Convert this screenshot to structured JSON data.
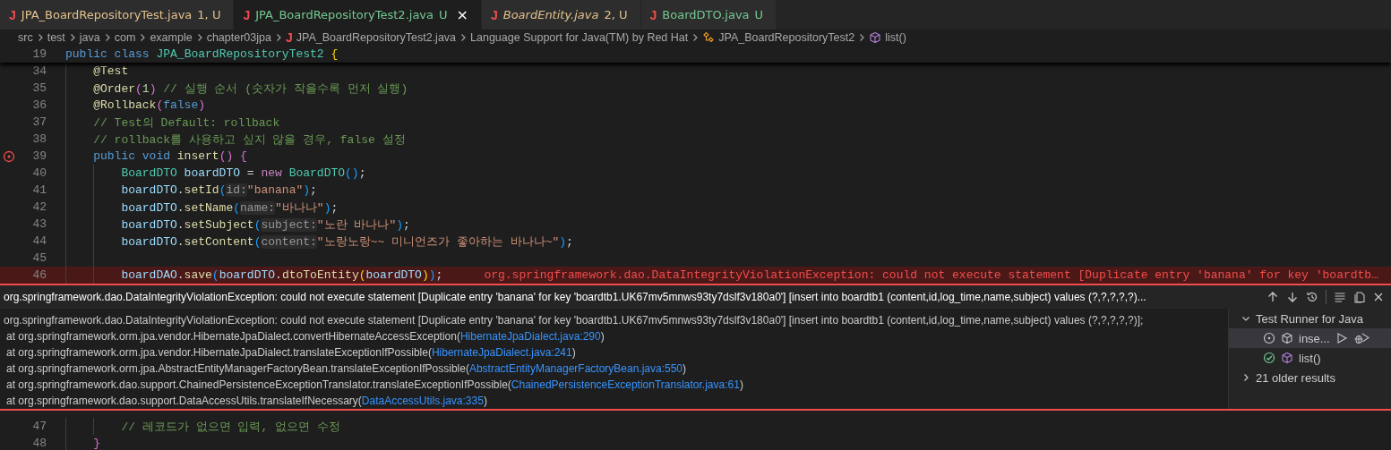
{
  "tabs": [
    {
      "icon": "J",
      "label": "JPA_BoardRepositoryTest.java",
      "status": "1, U",
      "color": "#e2c08d",
      "italic": false,
      "selected": false
    },
    {
      "icon": "J",
      "label": "JPA_BoardRepositoryTest2.java",
      "status": "U",
      "color": "#73c991",
      "italic": false,
      "selected": true,
      "close": "×"
    },
    {
      "icon": "J",
      "label": "BoardEntity.java",
      "status": "2, U",
      "color": "#e2c08d",
      "italic": true,
      "selected": false
    },
    {
      "icon": "J",
      "label": "BoardDTO.java",
      "status": "U",
      "color": "#73c991",
      "italic": false,
      "selected": false
    }
  ],
  "breadcrumb": [
    {
      "label": "src"
    },
    {
      "label": "test"
    },
    {
      "label": "java"
    },
    {
      "label": "com"
    },
    {
      "label": "example"
    },
    {
      "label": "chapter03jpa"
    },
    {
      "label": "JPA_BoardRepositoryTest2.java",
      "icon": "J"
    },
    {
      "label": "Language Support for Java(TM) by Red Hat"
    },
    {
      "label": "JPA_BoardRepositoryTest2",
      "kind": "class"
    },
    {
      "label": "list()",
      "kind": "method"
    }
  ],
  "sticky_line": {
    "number": "19",
    "tokens": [
      {
        "kind": "kw",
        "text": "public"
      },
      {
        "kind": "kw",
        "text": " class"
      },
      {
        "kind": "type",
        "text": " JPA_BoardRepositoryTest2"
      },
      {
        "kind": "b1",
        "text": " {"
      }
    ]
  },
  "code_lines": [
    {
      "number": "34",
      "kind": "member",
      "tokens": [
        {
          "kind": "fn",
          "text": "@Test"
        }
      ]
    },
    {
      "number": "35",
      "kind": "member",
      "tokens": [
        {
          "kind": "fn",
          "text": "@Order"
        },
        {
          "kind": "b2",
          "text": "("
        },
        {
          "kind": "num",
          "text": "1"
        },
        {
          "kind": "b2",
          "text": ")"
        },
        {
          "kind": "cmt",
          "text": " // 실행 순서 (숫자가 작을수록 먼저 실행)"
        }
      ]
    },
    {
      "number": "36",
      "kind": "member",
      "tokens": [
        {
          "kind": "fn",
          "text": "@Rollback"
        },
        {
          "kind": "b2",
          "text": "("
        },
        {
          "kind": "kw",
          "text": "false"
        },
        {
          "kind": "b2",
          "text": ")"
        }
      ]
    },
    {
      "number": "37",
      "kind": "member",
      "tokens": [
        {
          "kind": "cmt",
          "text": "// Test의 Default: rollback"
        }
      ]
    },
    {
      "number": "38",
      "kind": "member",
      "tokens": [
        {
          "kind": "cmt",
          "text": "// rollback를 사용하고 싶지 않을 경우, false 설정"
        }
      ]
    },
    {
      "number": "39",
      "kind": "member",
      "test_failed": true,
      "tokens": [
        {
          "kind": "kw",
          "text": "public"
        },
        {
          "kind": "kw",
          "text": " void"
        },
        {
          "kind": "fn",
          "text": " insert"
        },
        {
          "kind": "b2",
          "text": "()"
        },
        {
          "kind": "b2",
          "text": " {"
        }
      ]
    },
    {
      "number": "40",
      "kind": "statement",
      "tokens": [
        {
          "kind": "type",
          "text": "BoardDTO"
        },
        {
          "kind": "var",
          "text": " boardDTO"
        },
        {
          "kind": "p",
          "text": " = "
        },
        {
          "kind": "ctl",
          "text": "new"
        },
        {
          "kind": "type",
          "text": " BoardDTO"
        },
        {
          "kind": "b3",
          "text": "()"
        },
        {
          "kind": "p",
          "text": ";"
        }
      ]
    },
    {
      "number": "41",
      "kind": "statement",
      "tokens": [
        {
          "kind": "var",
          "text": "boardDTO"
        },
        {
          "kind": "p",
          "text": "."
        },
        {
          "kind": "fn",
          "text": "setId"
        },
        {
          "kind": "b3",
          "text": "("
        },
        {
          "kind": "hint",
          "text": "id:"
        },
        {
          "kind": "str",
          "text": "\"banana\""
        },
        {
          "kind": "b3",
          "text": ")"
        },
        {
          "kind": "p",
          "text": ";"
        }
      ]
    },
    {
      "number": "42",
      "kind": "statement",
      "tokens": [
        {
          "kind": "var",
          "text": "boardDTO"
        },
        {
          "kind": "p",
          "text": "."
        },
        {
          "kind": "fn",
          "text": "setName"
        },
        {
          "kind": "b3",
          "text": "("
        },
        {
          "kind": "hint",
          "text": "name:"
        },
        {
          "kind": "str",
          "text": "\"바나나\""
        },
        {
          "kind": "b3",
          "text": ")"
        },
        {
          "kind": "p",
          "text": ";"
        }
      ]
    },
    {
      "number": "43",
      "kind": "statement",
      "tokens": [
        {
          "kind": "var",
          "text": "boardDTO"
        },
        {
          "kind": "p",
          "text": "."
        },
        {
          "kind": "fn",
          "text": "setSubject"
        },
        {
          "kind": "b3",
          "text": "("
        },
        {
          "kind": "hint",
          "text": "subject:"
        },
        {
          "kind": "str",
          "text": "\"노란 바나나\""
        },
        {
          "kind": "b3",
          "text": ")"
        },
        {
          "kind": "p",
          "text": ";"
        }
      ]
    },
    {
      "number": "44",
      "kind": "statement",
      "tokens": [
        {
          "kind": "var",
          "text": "boardDTO"
        },
        {
          "kind": "p",
          "text": "."
        },
        {
          "kind": "fn",
          "text": "setContent"
        },
        {
          "kind": "b3",
          "text": "("
        },
        {
          "kind": "hint",
          "text": "content:"
        },
        {
          "kind": "str",
          "text": "\"노랑노랑~~ 미니언즈가 좋아하는 바나나~\""
        },
        {
          "kind": "b3",
          "text": ")"
        },
        {
          "kind": "p",
          "text": ";"
        }
      ]
    },
    {
      "number": "45",
      "kind": "statement"
    },
    {
      "number": "46",
      "kind": "statement",
      "error": "org.springframework.dao.DataIntegrityViolationException: could not execute statement [Duplicate entry 'banana' for key 'boardtb…",
      "tokens": [
        {
          "kind": "var",
          "text": "boardDAO"
        },
        {
          "kind": "p",
          "text": "."
        },
        {
          "kind": "fn",
          "text": "save"
        },
        {
          "kind": "b3",
          "text": "("
        },
        {
          "kind": "var",
          "text": "boardDTO"
        },
        {
          "kind": "p",
          "text": "."
        },
        {
          "kind": "fn",
          "text": "dtoToEntity"
        },
        {
          "kind": "b1",
          "text": "("
        },
        {
          "kind": "var",
          "text": "boardDTO"
        },
        {
          "kind": "b1",
          "text": ")"
        },
        {
          "kind": "b3",
          "text": ")"
        },
        {
          "kind": "p",
          "text": ";"
        }
      ]
    }
  ],
  "peek": {
    "title": "org.springframework.dao.DataIntegrityViolationException: could not execute statement [Duplicate entry 'banana' for key 'boardtb1.UK67mv5mnws93ty7dslf3v180a0'] [insert into boardtb1 (content,id,log_time,name,subject) values (?,?,?,?,?)...",
    "message": "org.springframework.dao.DataIntegrityViolationException: could not execute statement [Duplicate entry 'banana' for key 'boardtb1.UK67mv5mnws93ty7dslf3v180a0'] [insert into boardtb1 (content,id,log_time,name,subject) values (?,?,?,?,?)];",
    "stack": [
      {
        "text": "at org.springframework.orm.jpa.vendor.HibernateJpaDialect.convertHibernateAccessException(",
        "link": "HibernateJpaDialect.java:290",
        "suffix": ")"
      },
      {
        "text": "at org.springframework.orm.jpa.vendor.HibernateJpaDialect.translateExceptionIfPossible(",
        "link": "HibernateJpaDialect.java:241",
        "suffix": ")"
      },
      {
        "text": "at org.springframework.orm.jpa.AbstractEntityManagerFactoryBean.translateExceptionIfPossible(",
        "link": "AbstractEntityManagerFactoryBean.java:550",
        "suffix": ")"
      },
      {
        "text": "at org.springframework.dao.support.ChainedPersistenceExceptionTranslator.translateExceptionIfPossible(",
        "link": "ChainedPersistenceExceptionTranslator.java:61",
        "suffix": ")"
      },
      {
        "text": "at org.springframework.dao.support.DataAccessUtils.translateIfNecessary(",
        "link": "DataAccessUtils.java:335",
        "suffix": ")"
      }
    ],
    "test_tree": {
      "label": "Test Runner for Java",
      "expanded": true,
      "children": [
        {
          "label": "inse...",
          "kind": "running",
          "selected": true
        },
        {
          "label": "list()",
          "kind": "passed",
          "selected": false
        }
      ]
    },
    "older": {
      "label": "21 older results",
      "expanded": false
    }
  },
  "after_lines": [
    {
      "number": "47",
      "kind": "statement",
      "tokens": [
        {
          "kind": "cmt",
          "text": "// 레코드가 없으면 입력, 없으면 수정"
        }
      ]
    },
    {
      "number": "48",
      "kind": "member",
      "tokens": [
        {
          "kind": "b2",
          "text": "}"
        }
      ]
    }
  ]
}
